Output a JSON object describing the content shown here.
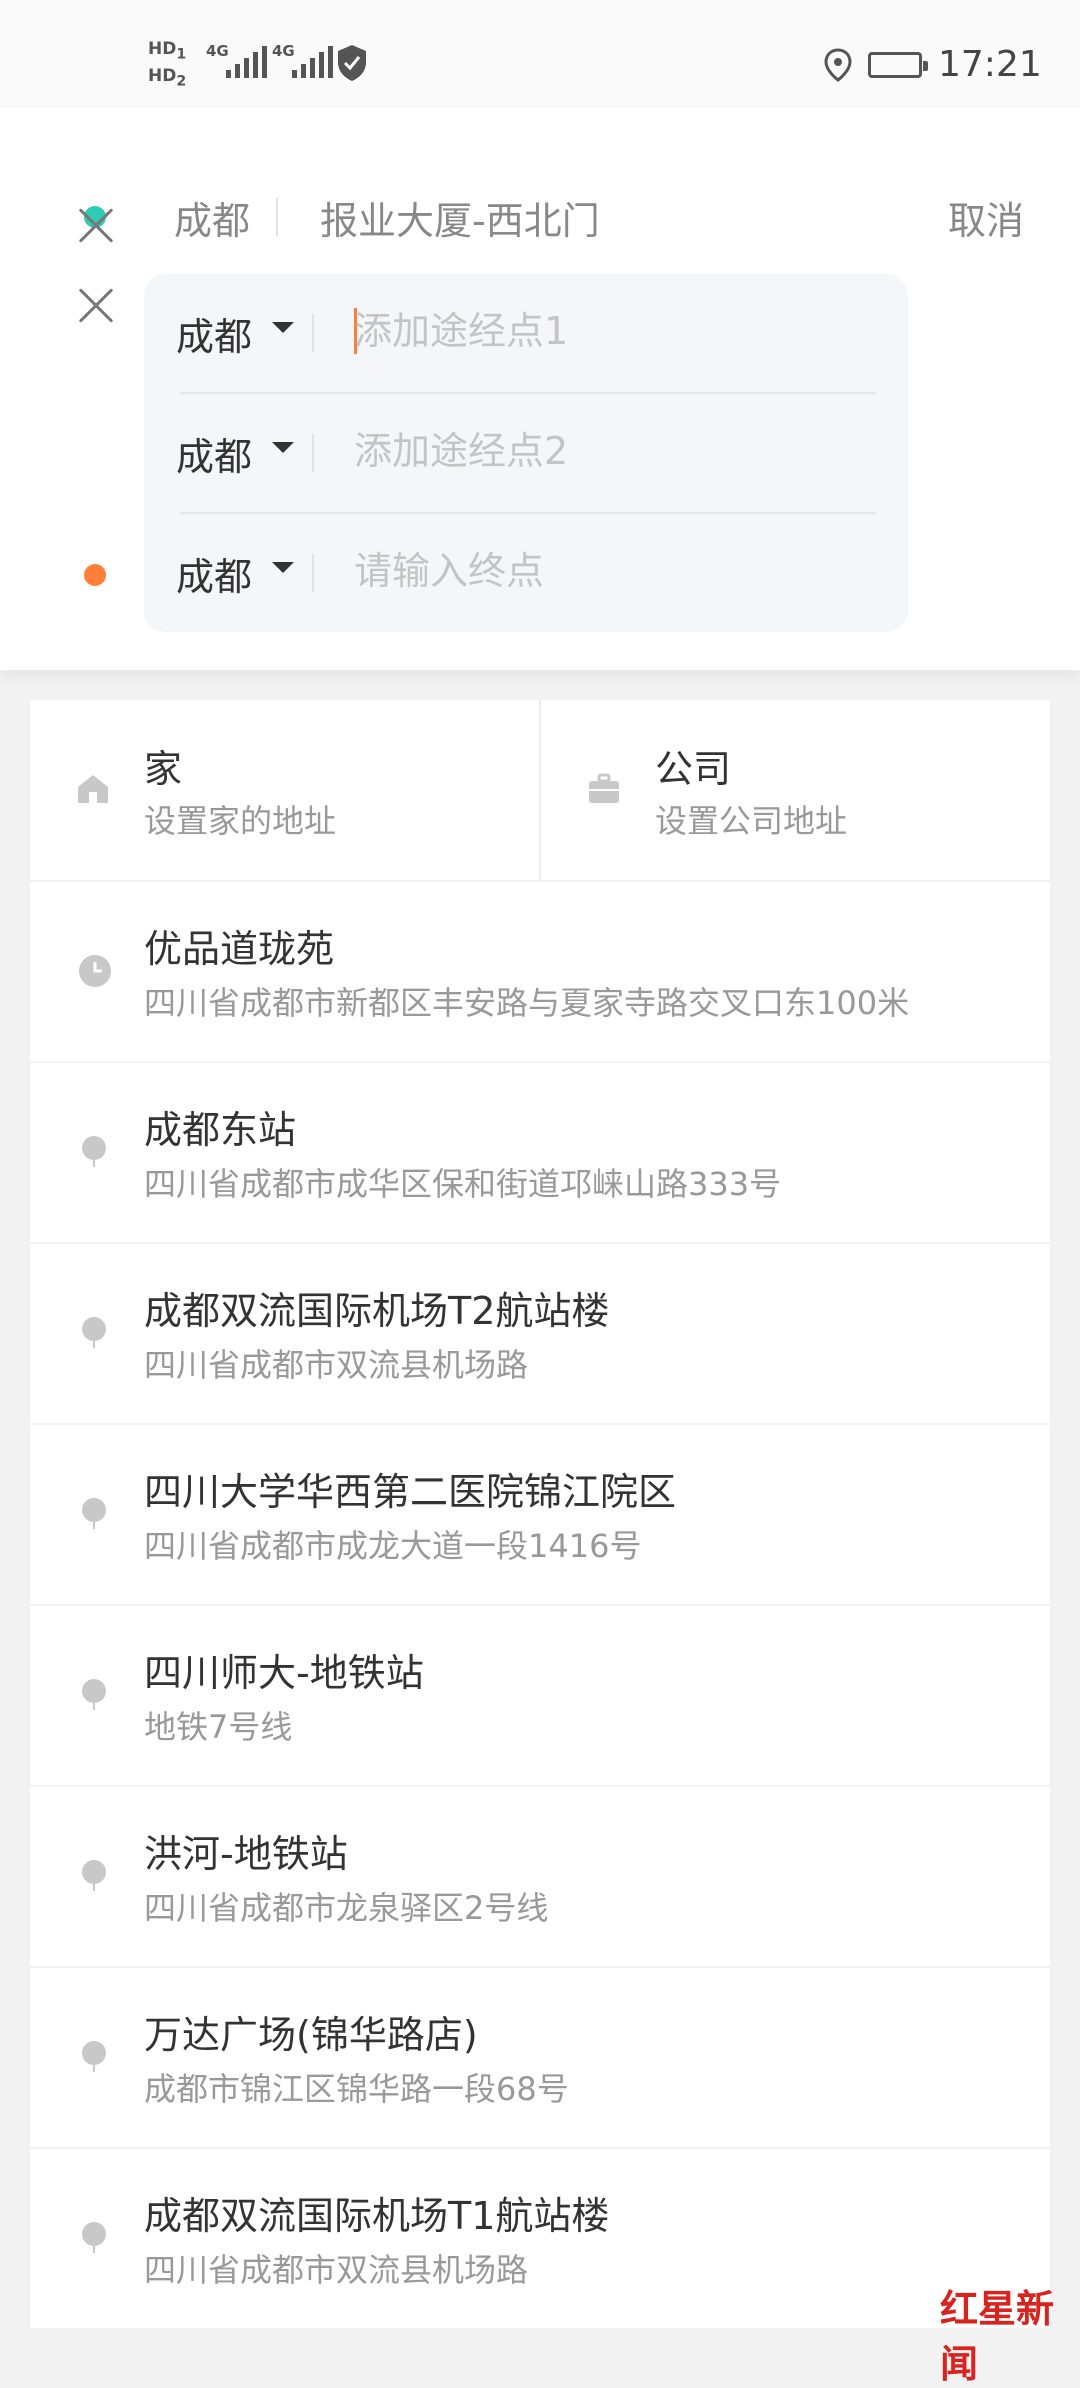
{
  "status_bar": {
    "sim1": "HD",
    "sim1_badge": "1",
    "sim2": "HD",
    "sim2_badge": "2",
    "network1": "4G",
    "network2": "4G",
    "time": "17:21",
    "icons": [
      "signal-icon",
      "shield-icon",
      "location-icon",
      "battery-icon"
    ]
  },
  "route": {
    "origin_city": "成都",
    "origin_place": "报业大厦-西北门",
    "cancel_label": "取消",
    "waypoints": [
      {
        "city": "成都",
        "placeholder": "添加途经点1"
      },
      {
        "city": "成都",
        "placeholder": "添加途经点2"
      }
    ],
    "destination": {
      "city": "成都",
      "placeholder": "请输入终点"
    },
    "colors": {
      "start_dot": "#2ecbb3",
      "end_dot": "#ff7f3a"
    }
  },
  "quick": [
    {
      "icon": "home-icon",
      "title": "家",
      "subtitle": "设置家的地址"
    },
    {
      "icon": "briefcase-icon",
      "title": "公司",
      "subtitle": "设置公司地址"
    }
  ],
  "places": [
    {
      "icon": "clock-icon",
      "title": "优品道珑苑",
      "subtitle": "四川省成都市新都区丰安路与夏家寺路交叉口东100米"
    },
    {
      "icon": "location-pin-icon",
      "title": "成都东站",
      "subtitle": "四川省成都市成华区保和街道邛崃山路333号"
    },
    {
      "icon": "location-pin-icon",
      "title": "成都双流国际机场T2航站楼",
      "subtitle": "四川省成都市双流县机场路"
    },
    {
      "icon": "location-pin-icon",
      "title": "四川大学华西第二医院锦江院区",
      "subtitle": "四川省成都市成龙大道一段1416号"
    },
    {
      "icon": "location-pin-icon",
      "title": "四川师大-地铁站",
      "subtitle": "地铁7号线"
    },
    {
      "icon": "location-pin-icon",
      "title": "洪河-地铁站",
      "subtitle": "四川省成都市龙泉驿区2号线"
    },
    {
      "icon": "location-pin-icon",
      "title": "万达广场(锦华路店)",
      "subtitle": "成都市锦江区锦华路一段68号"
    },
    {
      "icon": "location-pin-icon",
      "title": "成都双流国际机场T1航站楼",
      "subtitle": "四川省成都市双流县机场路"
    }
  ],
  "watermark": "红星新闻"
}
